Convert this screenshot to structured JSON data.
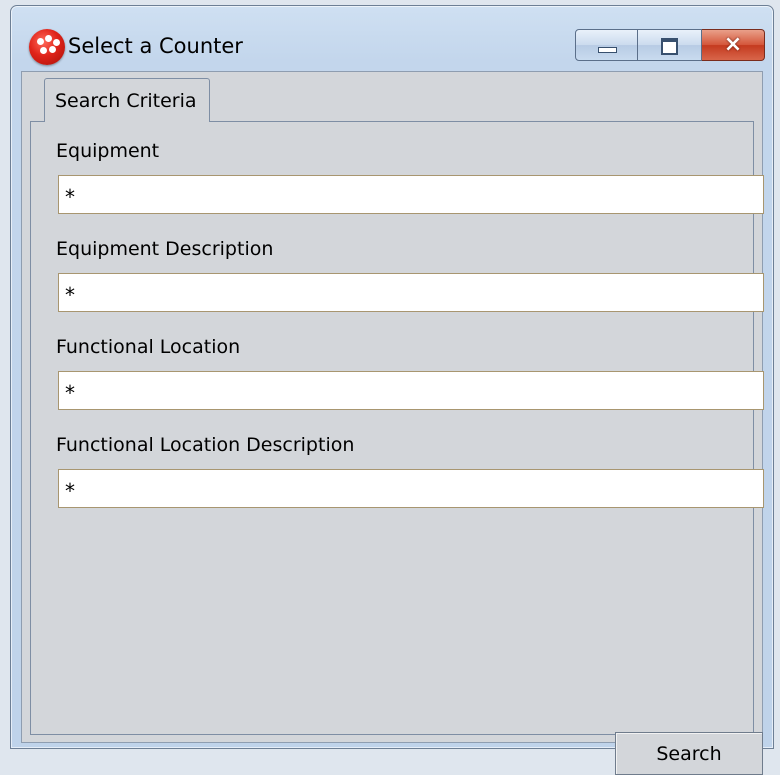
{
  "window": {
    "title": "Select a Counter",
    "controls": {
      "minimize": "minimize",
      "maximize": "maximize",
      "close": "×"
    }
  },
  "tabs": [
    {
      "label": "Search Criteria",
      "active": true
    }
  ],
  "form": {
    "fields": [
      {
        "label": "Equipment",
        "value": "*"
      },
      {
        "label": "Equipment Description",
        "value": "*"
      },
      {
        "label": "Functional Location",
        "value": "*"
      },
      {
        "label": "Functional Location Description",
        "value": "*"
      }
    ],
    "search_label": "Search"
  },
  "colors": {
    "frame": "#c3d6ec",
    "client": "#d3d6da",
    "input_border": "#a89670",
    "close_button": "#c43a1f"
  },
  "icons": {
    "app": "red-dice-icon",
    "minimize": "minimize-icon",
    "maximize": "maximize-icon",
    "close": "close-icon"
  }
}
